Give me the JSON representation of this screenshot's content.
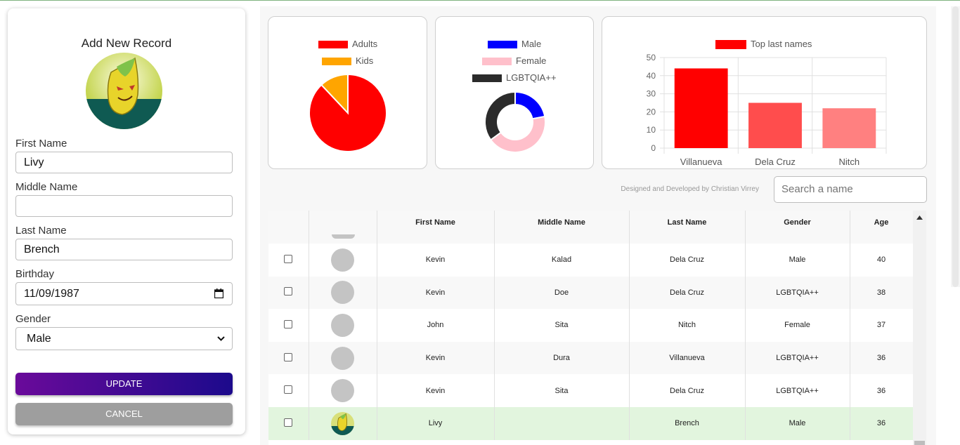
{
  "form": {
    "title": "Add New Record",
    "fields": {
      "first_name": {
        "label": "First Name",
        "value": "Livy"
      },
      "middle_name": {
        "label": "Middle Name",
        "value": ""
      },
      "last_name": {
        "label": "Last Name",
        "value": "Brench"
      },
      "birthday": {
        "label": "Birthday",
        "value": "11/09/1987"
      },
      "gender": {
        "label": "Gender",
        "value": "Male"
      }
    },
    "update_label": "UPDATE",
    "cancel_label": "CANCEL"
  },
  "charts": {
    "age_pie": {
      "legend": [
        "Adults",
        "Kids"
      ]
    },
    "gender_donut": {
      "legend": [
        "Male",
        "Female",
        "LGBTQIA++"
      ]
    },
    "lastname_bar": {
      "legend": "Top last names",
      "categories": [
        "Villanueva",
        "Dela Cruz",
        "Nitch"
      ],
      "ticks": [
        "50",
        "40",
        "30",
        "20",
        "10",
        "0"
      ]
    }
  },
  "chart_data": [
    {
      "type": "pie",
      "labels": [
        "Adults",
        "Kids"
      ],
      "values": [
        88,
        12
      ],
      "colors": [
        "#ff0000",
        "#ffa500"
      ]
    },
    {
      "type": "pie",
      "subtype": "doughnut",
      "labels": [
        "Male",
        "Female",
        "LGBTQIA++"
      ],
      "values": [
        22,
        43,
        35
      ],
      "colors": [
        "#0000ff",
        "#ffc0cb",
        "#2b2b2b"
      ]
    },
    {
      "type": "bar",
      "categories": [
        "Villanueva",
        "Dela Cruz",
        "Nitch"
      ],
      "series": [
        {
          "name": "Top last names",
          "values": [
            44,
            25,
            22
          ]
        }
      ],
      "ylim": [
        0,
        50
      ],
      "colors": [
        "#ff0000",
        "#ff4d4d",
        "#ff8080"
      ]
    }
  ],
  "footer": {
    "credit": "Designed and Developed by Christian Virrey",
    "search_placeholder": "Search a name"
  },
  "table": {
    "headers": [
      "",
      "",
      "First Name",
      "Middle Name",
      "Last Name",
      "Gender",
      "Age"
    ],
    "rows": [
      {
        "first": "Kevin",
        "middle": "Kalad",
        "last": "Dela Cruz",
        "gender": "Male",
        "age": "40",
        "avatar": "placeholder"
      },
      {
        "first": "Kevin",
        "middle": "Doe",
        "last": "Dela Cruz",
        "gender": "LGBTQIA++",
        "age": "38",
        "avatar": "placeholder"
      },
      {
        "first": "John",
        "middle": "Sita",
        "last": "Nitch",
        "gender": "Female",
        "age": "37",
        "avatar": "placeholder"
      },
      {
        "first": "Kevin",
        "middle": "Dura",
        "last": "Villanueva",
        "gender": "LGBTQIA++",
        "age": "36",
        "avatar": "placeholder"
      },
      {
        "first": "Kevin",
        "middle": "Sita",
        "last": "Dela Cruz",
        "gender": "LGBTQIA++",
        "age": "36",
        "avatar": "placeholder"
      },
      {
        "first": "Livy",
        "middle": "",
        "last": "Brench",
        "gender": "Male",
        "age": "36",
        "avatar": "leaf-character"
      }
    ]
  },
  "colors": {
    "accent_gradient_start": "#6a0a9a",
    "accent_gradient_end": "#1c0a8c",
    "selected_row": "#e2f5de"
  }
}
